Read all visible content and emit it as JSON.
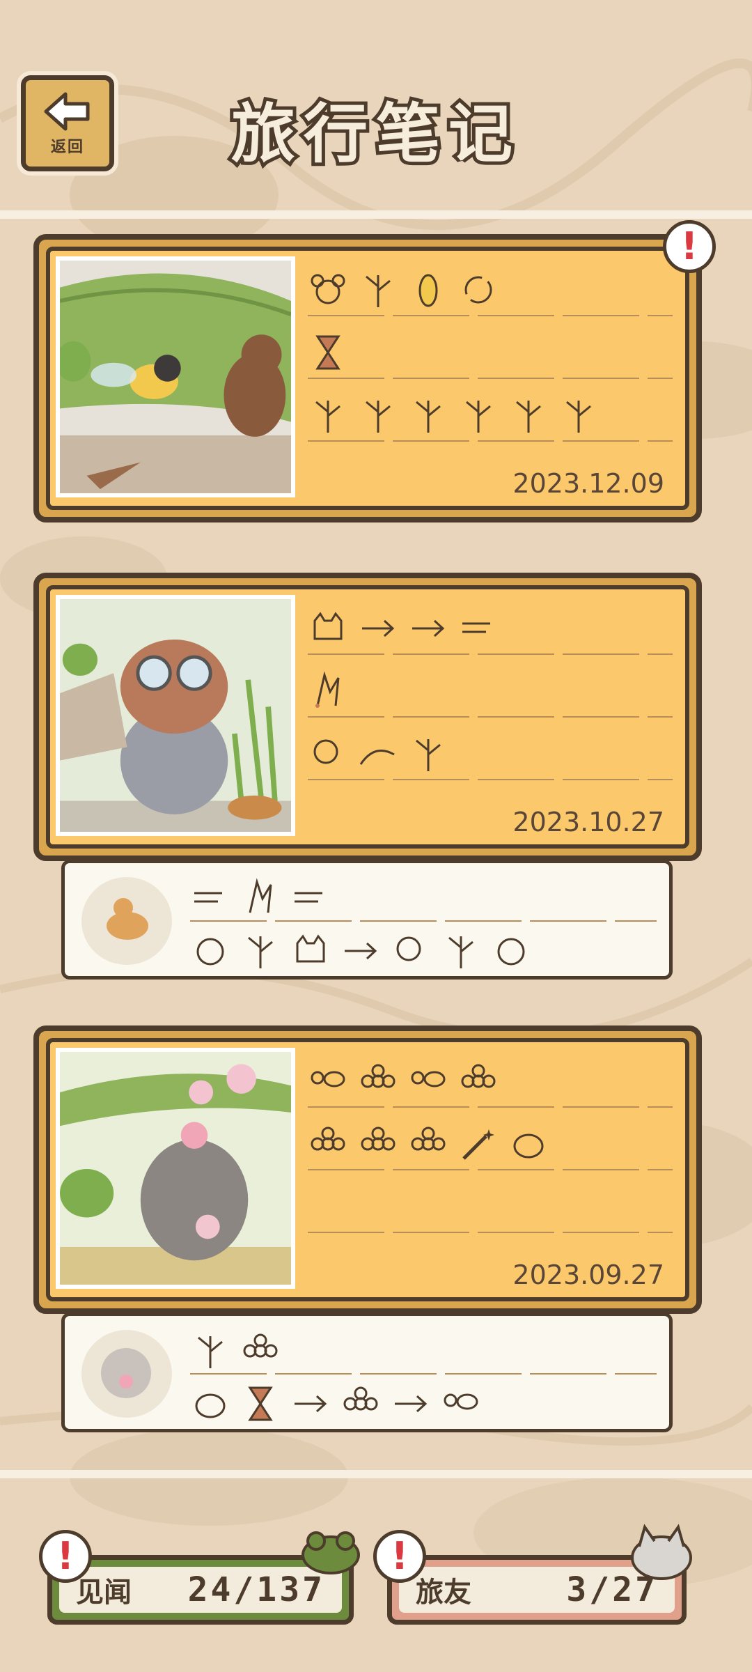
{
  "header": {
    "title": "旅行笔记",
    "back_label": "返回"
  },
  "entries": [
    {
      "date": "2023.12.09",
      "has_alert": true
    },
    {
      "date": "2023.10.27",
      "has_alert": false
    },
    {
      "date": "2023.09.27",
      "has_alert": false
    }
  ],
  "footer": {
    "stat_1": {
      "label": "见闻",
      "value": "24/137"
    },
    "stat_2": {
      "label": "旅友",
      "value": "3/27"
    }
  },
  "icons": {
    "back": "arrow-left-icon",
    "alert": "exclamation-icon",
    "frog": "frog-icon",
    "cat": "cat-icon"
  },
  "colors": {
    "background": "#e9d5bb",
    "card": "#fbc86c",
    "card_border": "#4d3b2b",
    "note": "#fbf8ef",
    "alert": "#d9393f",
    "stat_1_border": "#6d8b3c",
    "stat_2_border": "#e0a08c"
  }
}
